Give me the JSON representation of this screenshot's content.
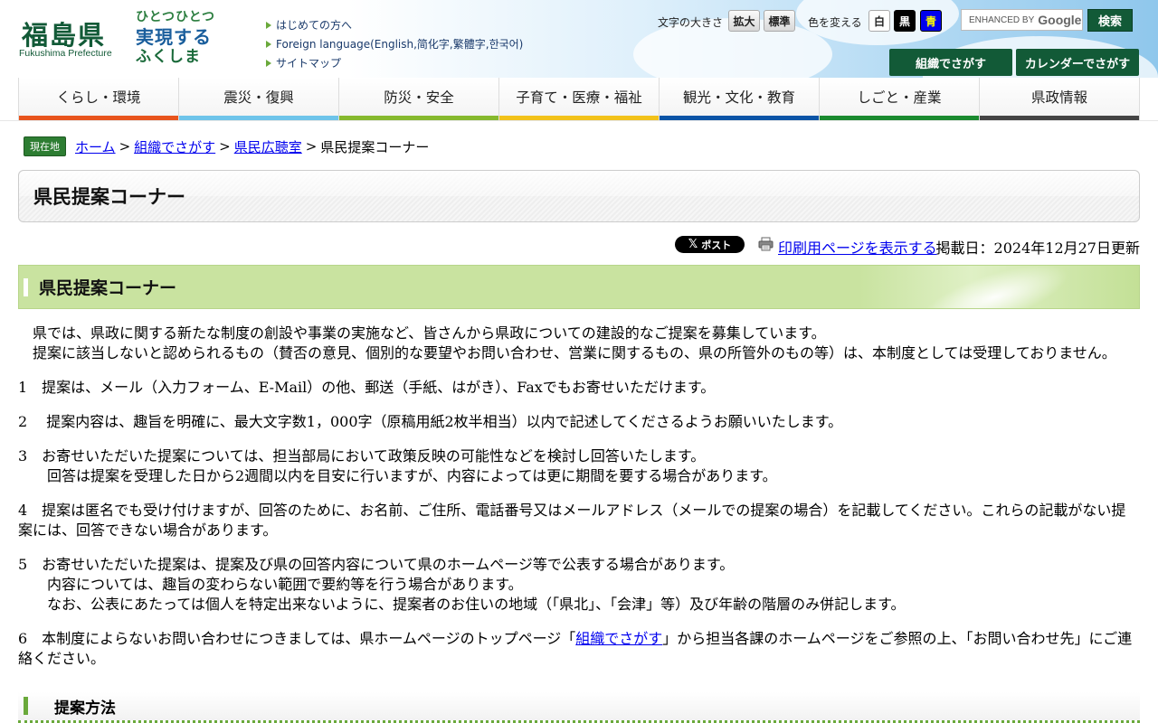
{
  "header": {
    "logo_name": "福島県",
    "logo_sub": "Fukushima Prefecture",
    "slogan_lines": [
      "ひとつひとつ",
      "実現する",
      "ふくしま"
    ],
    "links": [
      "はじめての方へ",
      "Foreign language(English,简化字,繁體字,한국어)",
      "サイトマップ"
    ],
    "font_size_label": "文字の大きさ",
    "font_large": "拡大",
    "font_standard": "標準",
    "color_label": "色を変える",
    "color_white": "白",
    "color_black": "黒",
    "color_blue": "青",
    "search_placeholder": "ENHANCED BY",
    "search_brand": "Google",
    "search_button": "検索",
    "org_search": "組織でさがす",
    "calendar_search": "カレンダーでさがす"
  },
  "nav": {
    "items": [
      {
        "label": "くらし・環境",
        "color": "#e8541c"
      },
      {
        "label": "震災・復興",
        "color": "#6ec4ea"
      },
      {
        "label": "防災・安全",
        "color": "#86b92e"
      },
      {
        "label": "子育て・医療・福祉",
        "color": "#f2c21a"
      },
      {
        "label": "観光・文化・教育",
        "color": "#0b54a6"
      },
      {
        "label": "しごと・産業",
        "color": "#1a8a2f"
      },
      {
        "label": "県政情報",
        "color": "#444444"
      }
    ]
  },
  "breadcrumb": {
    "here": "現在地",
    "items": [
      "ホーム",
      "組織でさがす",
      "県民広聴室"
    ],
    "sep": ">",
    "current": "県民提案コーナー"
  },
  "page_title": "県民提案コーナー",
  "meta": {
    "post": "ポスト",
    "print": "印刷用ページを表示する",
    "posted": "掲載日：2024年12月27日更新"
  },
  "section_title": "県民提案コーナー",
  "intro": [
    "県では、県政に関する新たな制度の創設や事業の実施など、皆さんから県政についての建設的なご提案を募集しています。",
    "提案に該当しないと認められるもの（賛否の意見、個別的な要望やお問い合わせ、営業に関するもの、県の所管外のもの等）は、本制度としては受理しておりません。"
  ],
  "items": {
    "i1": "1　提案は、メール（入力フォーム、E-Mail）の他、郵送（手紙、はがき）、Faxでもお寄せいただけます。",
    "i2": "2　 提案内容は、趣旨を明確に、最大文字数1，000字（原稿用紙2枚半相当）以内で記述してくださるようお願いいたします。",
    "i3a": "3　お寄せいただいた提案については、担当部局において政策反映の可能性などを検討し回答いたします。",
    "i3b": "回答は提案を受理した日から2週間以内を目安に行いますが、内容によっては更に期間を要する場合があります。",
    "i4": "4　提案は匿名でも受け付けますが、回答のために、お名前、ご住所、電話番号又はメールアドレス（メールでの提案の場合）を記載してください。これらの記載がない提案には、回答できない場合があります。",
    "i5a": "5　お寄せいただいた提案は、提案及び県の回答内容について県のホームページ等で公表する場合があります。",
    "i5b": "内容については、趣旨の変わらない範囲で要約等を行う場合があります。",
    "i5c": "なお、公表にあたっては個人を特定出来ないように、提案者のお住いの地域（「県北」、「会津」等）及び年齢の階層のみ併記します。",
    "i6_pre": "6　本制度によらないお問い合わせにつきましては、県ホームページのトップページ「",
    "i6_link": "組織でさがす",
    "i6_post": "」から担当各課のホームページをご参照の上、「お問い合わせ先」にご連絡ください。"
  },
  "sub_title": "提案方法"
}
